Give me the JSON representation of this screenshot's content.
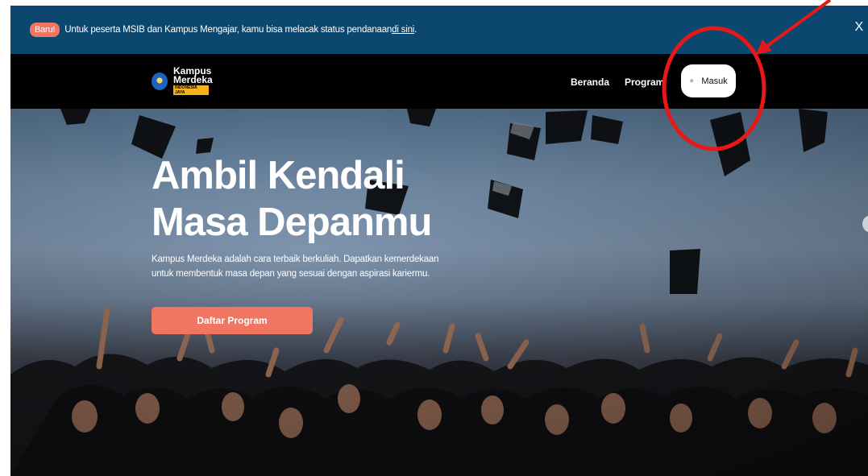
{
  "announcement": {
    "badge": "Baru!",
    "text": "Untuk peserta MSIB dan Kampus Mengajar, kamu bisa melacak status pendanaan ",
    "link": "di sini",
    "suffix": ".",
    "close": "X"
  },
  "nav": {
    "logo_line1": "Kampus",
    "logo_line2": "Merdeka",
    "logo_sub": "INDONESIA JAYA",
    "items": [
      {
        "label": "Beranda"
      },
      {
        "label": "Program"
      }
    ],
    "login_label": "Masuk",
    "login_icon": "user-icon"
  },
  "hero": {
    "title_line1": "Ambil Kendali",
    "title_line2": "Masa Depanmu",
    "description": "Kampus Merdeka adalah cara terbaik berkuliah. Dapatkan kemerdekaan untuk membentuk masa depan yang sesuai dengan aspirasi kariermu.",
    "cta_label": "Daftar Program"
  },
  "colors": {
    "announce_bg": "#0c4770",
    "accent": "#f07662",
    "nav_bg": "#000000",
    "annotation": "#e81818"
  }
}
